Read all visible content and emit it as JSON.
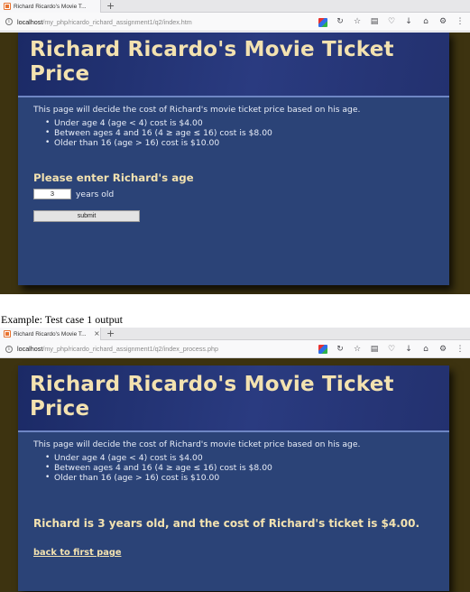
{
  "tab1": {
    "title": "Richard Ricardo's Movie T...",
    "new_tab": "+"
  },
  "url1": {
    "host": "localhost",
    "path": "/my_php/ricardo_richard_assignment1/q2/index.htm"
  },
  "caption": "Example: Test case 1 output",
  "tab2": {
    "title": "Richard Ricardo's Movie T...",
    "close": "×",
    "new_tab": "+"
  },
  "url2": {
    "host": "localhost",
    "path": "/my_php/ricardo_richard_assignment1/q2/index_process.php"
  },
  "page": {
    "heading": "Richard Ricardo's Movie Ticket Price",
    "intro": "This page will decide the cost of Richard's movie ticket price based on his age.",
    "rules": [
      "Under age 4 (age < 4) cost is $4.00",
      "Between ages 4 and 16 (4 ≥ age ≤ 16) cost is $8.00",
      "Older than 16 (age > 16) cost is $10.00"
    ]
  },
  "form": {
    "heading": "Please enter Richard's age",
    "age_value": "3",
    "age_unit": "years old",
    "submit_label": "submit"
  },
  "result": {
    "message": "Richard is 3 years old, and the cost of Richard's ticket is $4.00.",
    "back_link": "back to first page"
  },
  "icons": [
    "info-icon",
    "color-extension-icon",
    "reload-icon",
    "star-icon",
    "reader-icon",
    "pocket-icon",
    "download-icon",
    "home-icon",
    "settings-icon",
    "menu-icon"
  ]
}
